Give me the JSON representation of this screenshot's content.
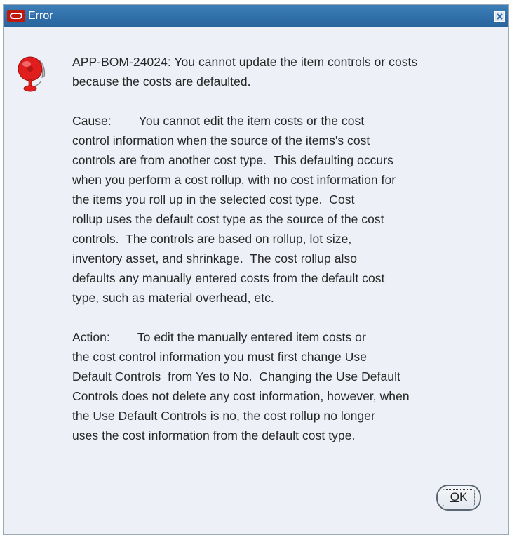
{
  "window": {
    "title": "Error"
  },
  "message": {
    "lines": [
      "APP-BOM-24024: You cannot update the item controls or costs",
      "because the costs are defaulted.",
      "",
      "Cause:        You cannot edit the item costs or the cost",
      "control information when the source of the items's cost",
      "controls are from another cost type.  This defaulting occurs",
      "when you perform a cost rollup, with no cost information for",
      "the items you roll up in the selected cost type.  Cost",
      "rollup uses the default cost type as the source of the cost",
      "controls.  The controls are based on rollup, lot size,",
      "inventory asset, and shrinkage.  The cost rollup also",
      "defaults any manually entered costs from the default cost",
      "type, such as material overhead, etc.",
      "",
      "Action:        To edit the manually entered item costs or",
      "the cost control information you must first change Use",
      "Default Controls  from Yes to No.  Changing the Use Default",
      "Controls does not delete any cost information, however, when",
      "the Use Default Controls is no, the cost rollup no longer",
      "uses the cost information from the default cost type."
    ]
  },
  "buttons": {
    "ok_mnemonic": "O",
    "ok_rest": "K"
  },
  "icons": {
    "title_logo": "oracle-logo-icon",
    "close": "close-icon",
    "message": "alarm-bell-icon"
  },
  "colors": {
    "titlebar": "#2f6ea8",
    "dialog_background": "#edf1f7",
    "logo_red": "#c0180e",
    "bell_red": "#e01e1e"
  }
}
